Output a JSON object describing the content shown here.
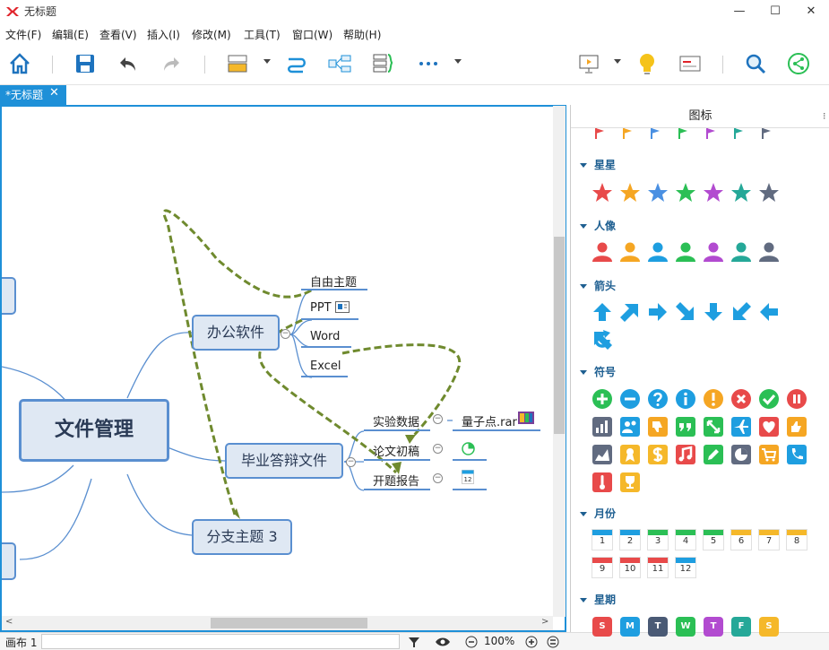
{
  "window": {
    "title": "无标题",
    "minimize": "—",
    "maximize": "☐",
    "close": "✕"
  },
  "menu": [
    "文件(F)",
    "编辑(E)",
    "查看(V)",
    "插入(I)",
    "修改(M)",
    "工具(T)",
    "窗口(W)",
    "帮助(H)"
  ],
  "tab": {
    "label": "*无标题",
    "close": "✕"
  },
  "panel": {
    "title": "图标",
    "sections": [
      {
        "title": "星星",
        "icon": "star-icon",
        "colors": [
          "#e84a4a",
          "#f5a623",
          "#4a90e2",
          "#2bbf55",
          "#b24bd0",
          "#25a898",
          "#616b80"
        ]
      },
      {
        "title": "人像",
        "icon": "person-icon",
        "colors": [
          "#e84a4a",
          "#f5a623",
          "#1e9ee0",
          "#2bbf55",
          "#b24bd0",
          "#25a898",
          "#616b80"
        ]
      },
      {
        "title": "箭头",
        "icon": "arrow-icon"
      },
      {
        "title": "符号",
        "icon": "symbol-icon"
      },
      {
        "title": "月份",
        "months": [
          "1",
          "2",
          "3",
          "4",
          "5",
          "6",
          "7",
          "8",
          "9",
          "10",
          "11",
          "12"
        ]
      },
      {
        "title": "星期",
        "days": [
          "S",
          "M",
          "T",
          "W",
          "T",
          "F",
          "S"
        ],
        "day_colors": [
          "#e84a4a",
          "#1e9ee0",
          "#4a5a75",
          "#2bbf55",
          "#b24bd0",
          "#25a898",
          "#f5b82a"
        ]
      }
    ],
    "flag_colors": [
      "#e84a4a",
      "#f5a623",
      "#4a90e2",
      "#2bbf55",
      "#b24bd0",
      "#25a898",
      "#616b80"
    ]
  },
  "mindmap": {
    "central": "文件管理",
    "branches": [
      {
        "label": "办公软件",
        "children": [
          "自由主题",
          "PPT",
          "Word",
          "Excel"
        ]
      },
      {
        "label": "毕业答辩文件",
        "children": [
          "实验数据",
          "论文初稿",
          "开题报告"
        ]
      },
      {
        "label": "分支主题 3"
      }
    ],
    "attachment": "量子点.rar"
  },
  "status": {
    "canvas_tab": "画布 1",
    "zoom": "100%"
  }
}
